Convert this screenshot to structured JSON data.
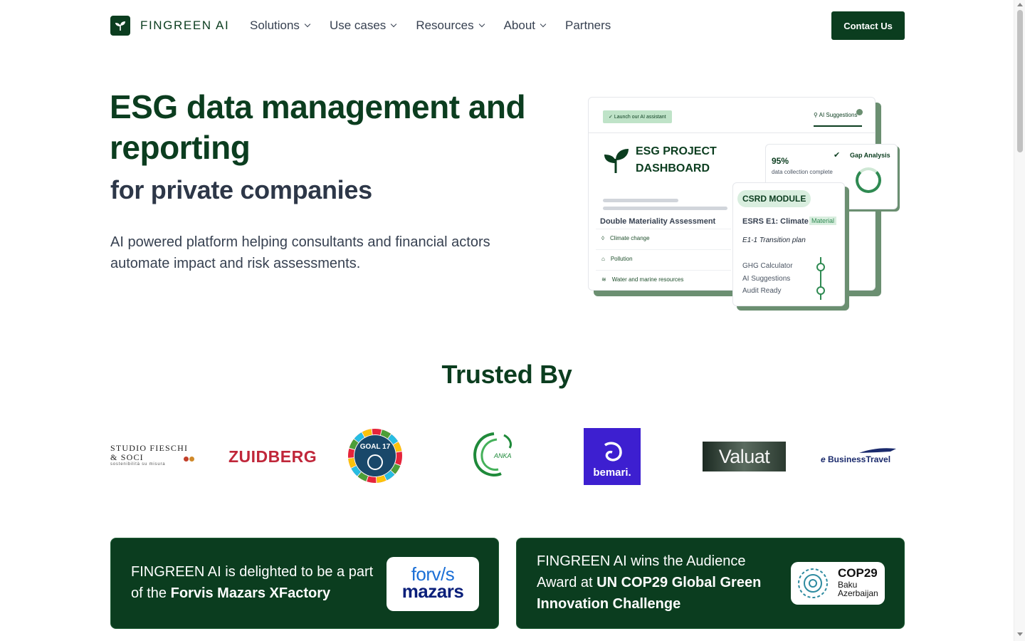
{
  "nav": {
    "brand": "FINGREEN AI",
    "items": [
      {
        "label": "Solutions",
        "dropdown": true
      },
      {
        "label": "Use cases",
        "dropdown": true
      },
      {
        "label": "Resources",
        "dropdown": true
      },
      {
        "label": "About",
        "dropdown": true
      },
      {
        "label": "Partners",
        "dropdown": false
      }
    ],
    "cta": "Contact Us"
  },
  "hero": {
    "title": "ESG data management and reporting",
    "subtitle": "for private companies",
    "description": "AI powered platform helping consultants and financial actors automate impact and risk assessments."
  },
  "dashboard": {
    "launch": "Launch our AI assistant",
    "ai_suggestions": "AI Suggestions",
    "project_title_1": "ESG PROJECT",
    "project_title_2": "DASHBOARD",
    "dma_title": "Double Materiality Assessment",
    "dma_rows": [
      "Climate change",
      "Pollution",
      "Water and marine resources"
    ],
    "gap": {
      "percent": "95%",
      "sub": "data collection complete",
      "title": "Gap Analysis"
    },
    "csrd": {
      "pill": "CSRD MODULE",
      "esrs": "ESRS E1: Climate",
      "material": "Material",
      "transition": "E1-1 Transition plan",
      "features": [
        "GHG Calculator",
        "AI Suggestions",
        "Audit Ready"
      ]
    }
  },
  "trusted": {
    "title": "Trusted By",
    "logos": {
      "studio": {
        "line1": "STUDIO FIESCHI",
        "line2": "& SOCI",
        "line3": "sostenibilità su misura"
      },
      "zuidberg": "ZUIDBERG",
      "goal17": "GOAL 17",
      "anka": "ANKA",
      "bemari": "bemari.",
      "valuat": "Valuat",
      "ebusiness": "BusinessTravel"
    }
  },
  "news": [
    {
      "text": "FINGREEN AI is delighted to be a part of the ",
      "highlight": "Forvis Mazars XFactory",
      "badge_line1": "forv/s",
      "badge_line2": "mazars"
    },
    {
      "text": "FINGREEN AI wins the Audience Award at ",
      "highlight": "UN COP29 Global Green Innovation Challenge",
      "badge_line1": "COP29",
      "badge_line2": "Baku",
      "badge_line3": "Azerbaijan"
    }
  ],
  "colors": {
    "brand": "#0b3d1f",
    "accent": "#2f8a52",
    "shadow": "#6b8f71"
  }
}
